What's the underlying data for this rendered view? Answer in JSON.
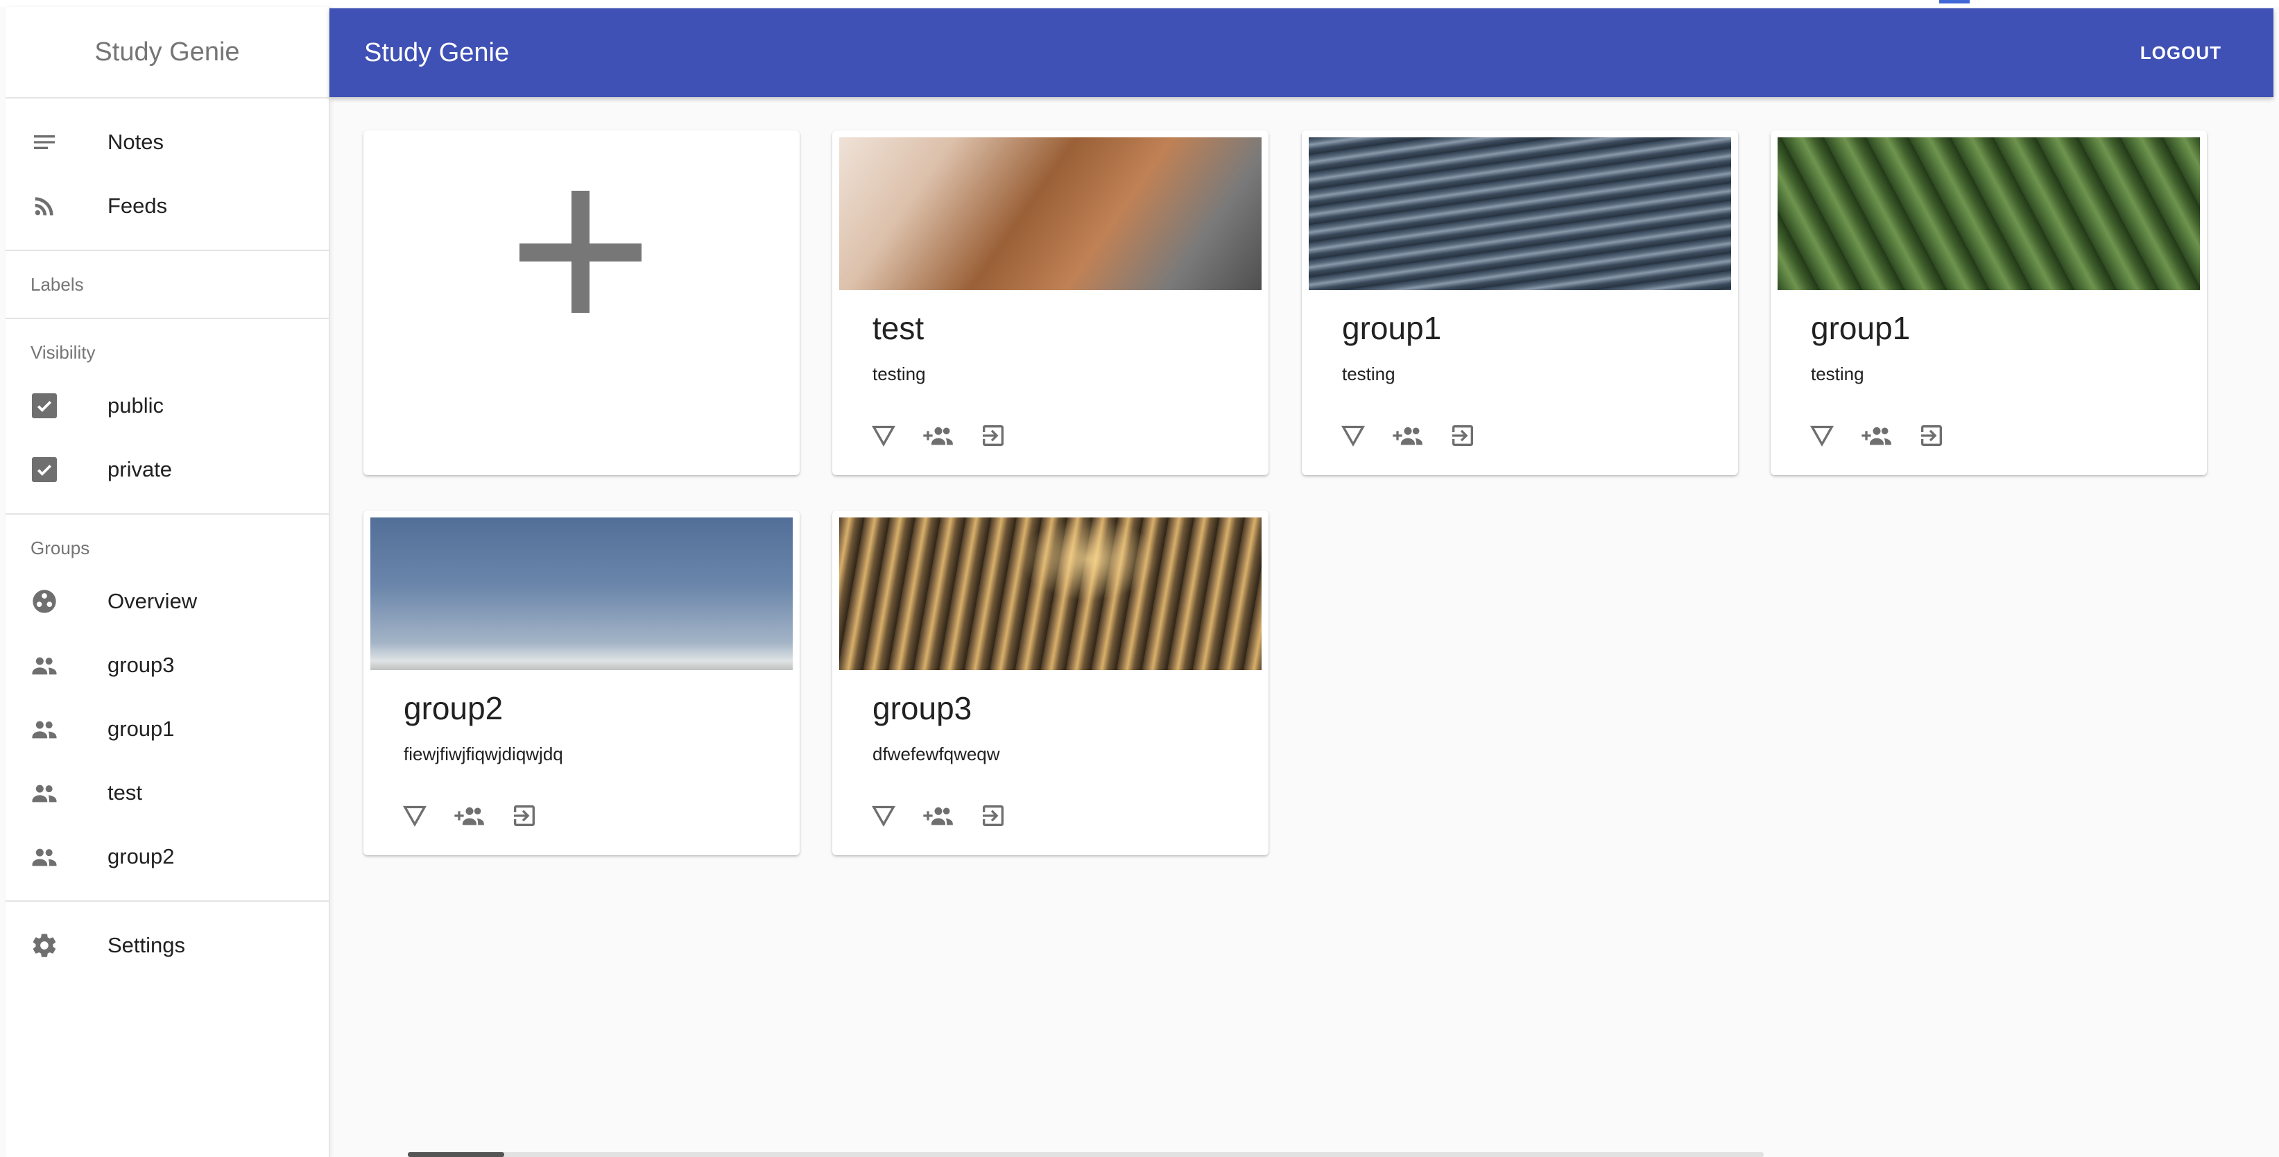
{
  "app": {
    "name": "Study Genie"
  },
  "sidebar": {
    "title": "Study Genie",
    "nav": [
      {
        "label": "Notes",
        "icon": "notes-icon"
      },
      {
        "label": "Feeds",
        "icon": "rss-feed-icon"
      }
    ],
    "labels_header": "Labels",
    "visibility_header": "Visibility",
    "visibility": [
      {
        "label": "public",
        "checked": true
      },
      {
        "label": "private",
        "checked": true
      }
    ],
    "groups_header": "Groups",
    "groups": [
      {
        "label": "Overview",
        "icon": "overview-icon"
      },
      {
        "label": "group3",
        "icon": "people-icon"
      },
      {
        "label": "group1",
        "icon": "people-icon"
      },
      {
        "label": "test",
        "icon": "people-icon"
      },
      {
        "label": "group2",
        "icon": "people-icon"
      }
    ],
    "settings": {
      "label": "Settings",
      "icon": "gear-icon"
    }
  },
  "appbar": {
    "title": "Study Genie",
    "logout_label": "LOGOUT"
  },
  "cards": [
    {
      "title": "test",
      "subtitle": "testing",
      "image": "desk-tools-photo"
    },
    {
      "title": "group1",
      "subtitle": "testing",
      "image": "water-photo"
    },
    {
      "title": "group1",
      "subtitle": "testing",
      "image": "tea-field-photo"
    },
    {
      "title": "group2",
      "subtitle": "fiewjfiwjfiqwjdiqwjdq",
      "image": "sky-photo"
    },
    {
      "title": "group3",
      "subtitle": "dfwefewfqweqw",
      "image": "dry-grass-photo"
    }
  ],
  "card_actions": [
    "filter-icon",
    "add-member-icon",
    "enter-group-icon"
  ],
  "colors": {
    "appbar": "#3f51b5",
    "icon": "#6f6f6f",
    "background": "#fafafa"
  }
}
